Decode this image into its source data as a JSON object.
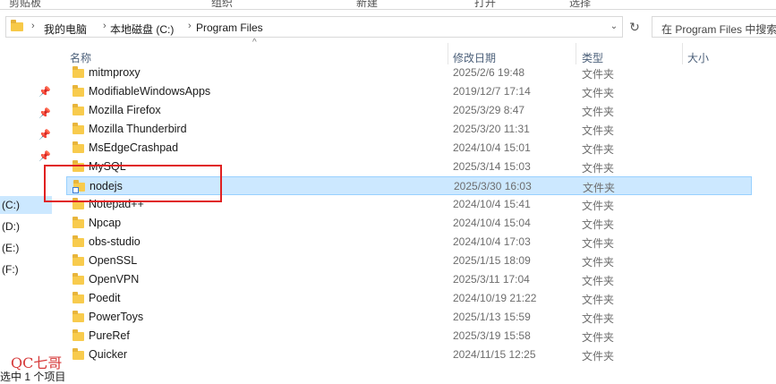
{
  "ribbon": {
    "groups": [
      "剪贴板",
      "组织",
      "新建",
      "打开",
      "选择"
    ]
  },
  "address_bar": {
    "crumbs": [
      "我的电脑",
      "本地磁盘 (C:)",
      "Program Files"
    ],
    "folder_icon": "folder-icon",
    "dropdown_icon": "chevron-down-icon"
  },
  "refresh_icon": "refresh-icon",
  "search": {
    "placeholder": "在 Program Files 中搜索"
  },
  "nav": {
    "drives": [
      {
        "label": "(C:)",
        "selected": true
      },
      {
        "label": "(D:)",
        "selected": false
      },
      {
        "label": "(E:)",
        "selected": false
      },
      {
        "label": "(F:)",
        "selected": false
      }
    ]
  },
  "columns": {
    "name": "名称",
    "modified": "修改日期",
    "type": "类型",
    "size": "大小"
  },
  "files": [
    {
      "name": "mitmproxy",
      "date": "2025/2/6 19:48",
      "type": "文件夹",
      "selected": false
    },
    {
      "name": "ModifiableWindowsApps",
      "date": "2019/12/7 17:14",
      "type": "文件夹",
      "selected": false
    },
    {
      "name": "Mozilla Firefox",
      "date": "2025/3/29 8:47",
      "type": "文件夹",
      "selected": false
    },
    {
      "name": "Mozilla Thunderbird",
      "date": "2025/3/20 11:31",
      "type": "文件夹",
      "selected": false
    },
    {
      "name": "MsEdgeCrashpad",
      "date": "2024/10/4 15:01",
      "type": "文件夹",
      "selected": false
    },
    {
      "name": "MySQL",
      "date": "2025/3/14 15:03",
      "type": "文件夹",
      "selected": false
    },
    {
      "name": "nodejs",
      "date": "2025/3/30 16:03",
      "type": "文件夹",
      "selected": true
    },
    {
      "name": "Notepad++",
      "date": "2024/10/4 15:41",
      "type": "文件夹",
      "selected": false
    },
    {
      "name": "Npcap",
      "date": "2024/10/4 15:04",
      "type": "文件夹",
      "selected": false
    },
    {
      "name": "obs-studio",
      "date": "2024/10/4 17:03",
      "type": "文件夹",
      "selected": false
    },
    {
      "name": "OpenSSL",
      "date": "2025/1/15 18:09",
      "type": "文件夹",
      "selected": false
    },
    {
      "name": "OpenVPN",
      "date": "2025/3/11 17:04",
      "type": "文件夹",
      "selected": false
    },
    {
      "name": "Poedit",
      "date": "2024/10/19 21:22",
      "type": "文件夹",
      "selected": false
    },
    {
      "name": "PowerToys",
      "date": "2025/1/13 15:59",
      "type": "文件夹",
      "selected": false
    },
    {
      "name": "PureRef",
      "date": "2025/3/19 15:58",
      "type": "文件夹",
      "selected": false
    },
    {
      "name": "Quicker",
      "date": "2024/11/15 12:25",
      "type": "文件夹",
      "selected": false
    }
  ],
  "status_bar": {
    "text": "选中 1 个项目"
  },
  "watermark": "QC七哥",
  "colors": {
    "selection": "#cce8ff",
    "selection_border": "#99d1ff",
    "annotation_red": "#e02020",
    "folder_yellow": "#f8cb4d"
  }
}
